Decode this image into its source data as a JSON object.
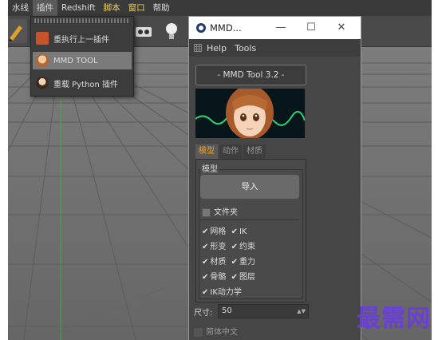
{
  "menubar": {
    "items": [
      {
        "label": "水线"
      },
      {
        "label": "插件"
      },
      {
        "label": "Redshift"
      },
      {
        "label": "脚本"
      },
      {
        "label": "窗口"
      },
      {
        "label": "帮助"
      }
    ]
  },
  "dropdown": {
    "items": [
      {
        "label": "重执行上一插件",
        "icon": "plugin-icon"
      },
      {
        "label": "MMD TOOL",
        "icon": "mmd-avatar-icon"
      },
      {
        "label": "重载 Python 插件",
        "icon": "python-reload-icon"
      }
    ]
  },
  "window": {
    "title": "MMD...",
    "menu": {
      "help": "Help",
      "tools": "Tools"
    },
    "header_button": "- MMD Tool 3.2 -",
    "tabs": [
      {
        "label": "模型"
      },
      {
        "label": "动作"
      },
      {
        "label": "材质"
      }
    ],
    "model_group": {
      "label": "模型",
      "import_button": "导入",
      "folder_checkbox": "文件夹",
      "options": [
        {
          "left": "网格",
          "right": "IK"
        },
        {
          "left": "形变",
          "right": "约束"
        },
        {
          "left": "材质",
          "right": "重力"
        },
        {
          "left": "骨骼",
          "right": "图层"
        },
        {
          "left": "IK动力学",
          "right": ""
        }
      ]
    },
    "size_label": "尺寸:",
    "size_value": "50",
    "traditional_label": "简体中文"
  },
  "watermark": "最需网",
  "colors": {
    "accent_tab": "#f0a020",
    "watermark": "#6a3fd6",
    "window_bg": "#464646"
  }
}
